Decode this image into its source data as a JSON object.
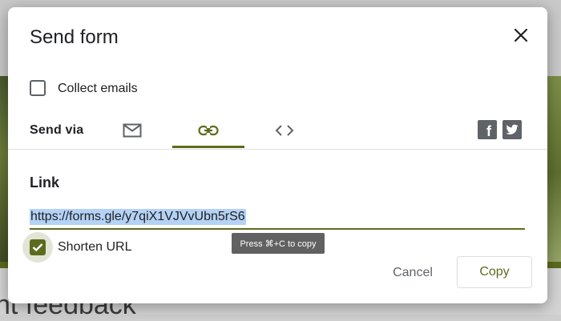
{
  "background": {
    "headline_fragment": "nt feedback"
  },
  "dialog": {
    "title": "Send form",
    "close_icon": "close-icon",
    "collect_emails": {
      "label": "Collect emails",
      "checked": false
    },
    "send_via": {
      "label": "Send via",
      "tabs": [
        {
          "name": "email",
          "icon": "mail-icon",
          "selected": false
        },
        {
          "name": "link",
          "icon": "link-icon",
          "selected": true
        },
        {
          "name": "embed",
          "icon": "code-icon",
          "selected": false
        }
      ],
      "social": [
        {
          "name": "facebook",
          "icon": "facebook-icon",
          "glyph": "f"
        },
        {
          "name": "twitter",
          "icon": "twitter-icon"
        }
      ]
    },
    "link_section": {
      "heading": "Link",
      "url": "https://forms.gle/y7qiX1VJVvUbn5rS6",
      "tooltip": "Press ⌘+C to copy"
    },
    "shorten_url": {
      "label": "Shorten URL",
      "checked": true
    },
    "actions": {
      "cancel_label": "Cancel",
      "copy_label": "Copy"
    }
  },
  "colors": {
    "accent": "#5c6b1e",
    "text": "#202124",
    "secondary_text": "#5f6368",
    "selection": "#b4d2f5",
    "tooltip_bg": "#616161"
  }
}
